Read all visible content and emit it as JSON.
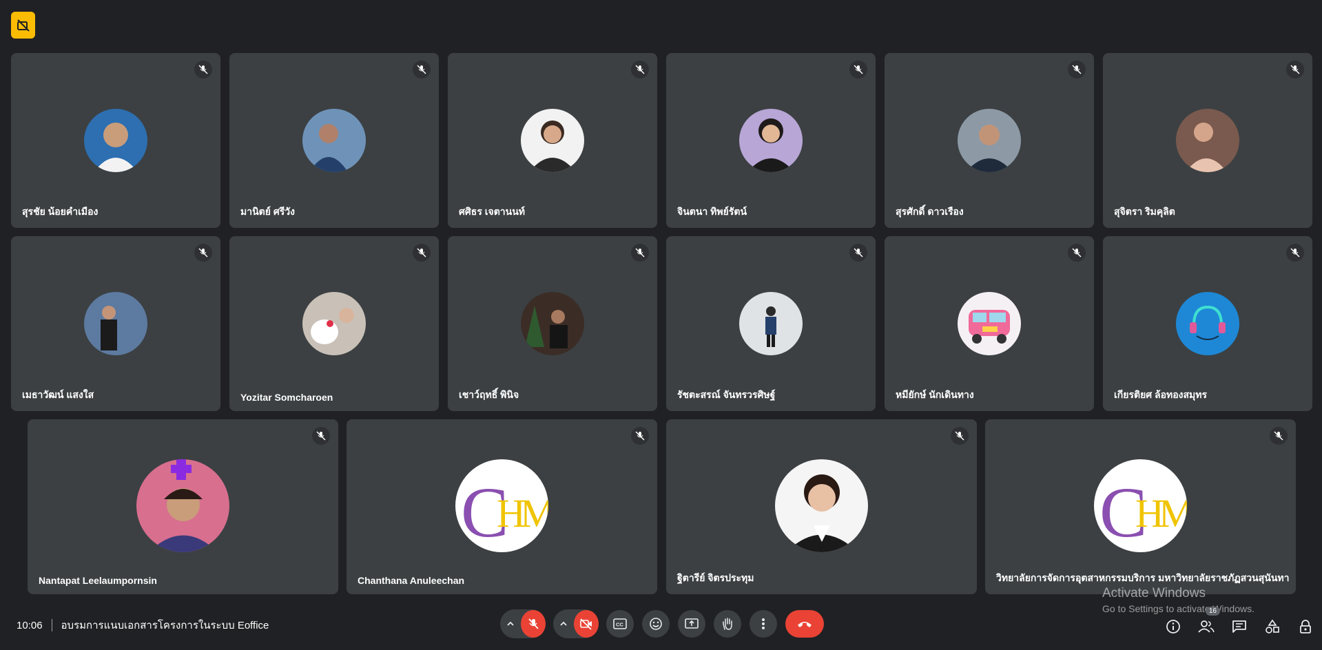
{
  "row1": [
    {
      "name": "สุรชัย น้อยคำเมือง",
      "avatar": "avatar-photo",
      "bg": "#2d6fb0"
    },
    {
      "name": "มานิตย์ ศรีวัง",
      "avatar": "avatar-photo",
      "bg": "#6f93b8"
    },
    {
      "name": "ศศิธร เจตานนท์",
      "avatar": "avatar-photo",
      "bg": "#f2f2f2"
    },
    {
      "name": "จินตนา ทิพย์รัตน์",
      "avatar": "avatar-photo",
      "bg": "#b8a6d6"
    },
    {
      "name": "สุรศักดิ์ ดาวเรือง",
      "avatar": "avatar-photo",
      "bg": "#8d9aa6"
    },
    {
      "name": "สุจิตรา ริมคุลิต",
      "avatar": "avatar-photo",
      "bg": "#7a5a4e"
    }
  ],
  "row2": [
    {
      "name": "เมธาวัฒน์ แสงใส",
      "avatar": "avatar-photo",
      "bg": "#5d7aa0"
    },
    {
      "name": "Yozitar Somcharoen",
      "avatar": "avatar-photo",
      "bg": "#c9c1b8"
    },
    {
      "name": "เชาว์ฤทธิ์ พินิจ",
      "avatar": "avatar-photo",
      "bg": "#3b2d26"
    },
    {
      "name": "รัชตะสรณ์ จันทรวรศิษฐ์",
      "avatar": "avatar-photo",
      "bg": "#dfe3e6"
    },
    {
      "name": "หมียักษ์ นักเดินทาง",
      "avatar": "avatar-photo",
      "bg": "#f5f0f4"
    },
    {
      "name": "เกียรติยศ ล้อทองสมุทร",
      "avatar": "avatar-photo",
      "bg": "#1e88d6"
    }
  ],
  "row3": [
    {
      "name": "Nantapat Leelaumpornsin",
      "avatar": "avatar-photo",
      "bg": "#d86f8f"
    },
    {
      "name": "Chanthana Anuleechan",
      "avatar": "chm-logo",
      "bg": "#ffffff"
    },
    {
      "name": "ฐิตารีย์ จิตรประทุม",
      "avatar": "avatar-photo",
      "bg": "#f5f5f5"
    },
    {
      "name": "วิทยาลัยการจัดการอุตสาหกรรมบริการ มหาวิทยาลัยราชภัฏสวนสุนันทา",
      "avatar": "chm-logo",
      "bg": "#ffffff"
    }
  ],
  "logo": {
    "c": "C",
    "h": "H",
    "m": "M"
  },
  "bottom": {
    "time": "10:06",
    "meeting_title": "อบรมการแนบเอกสารโครงการในระบบ Eoffice",
    "participants_count": "16"
  },
  "watermark": {
    "line1": "Activate Windows",
    "line2": "Go to Settings to activate Windows."
  },
  "colors": {
    "tile": "#3c4043",
    "background": "#202124",
    "danger": "#ea4335",
    "badge": "#fbbc04",
    "logo_purple": "#8a4fb0",
    "logo_yellow": "#f0c400"
  },
  "icons": [
    "meeting-badge-icon",
    "mic-off-icon",
    "camera-off-icon",
    "captions-icon",
    "emoji-icon",
    "present-icon",
    "raise-hand-icon",
    "more-options-icon",
    "end-call-icon",
    "info-icon",
    "people-icon",
    "chat-icon",
    "activities-icon",
    "host-controls-icon"
  ]
}
